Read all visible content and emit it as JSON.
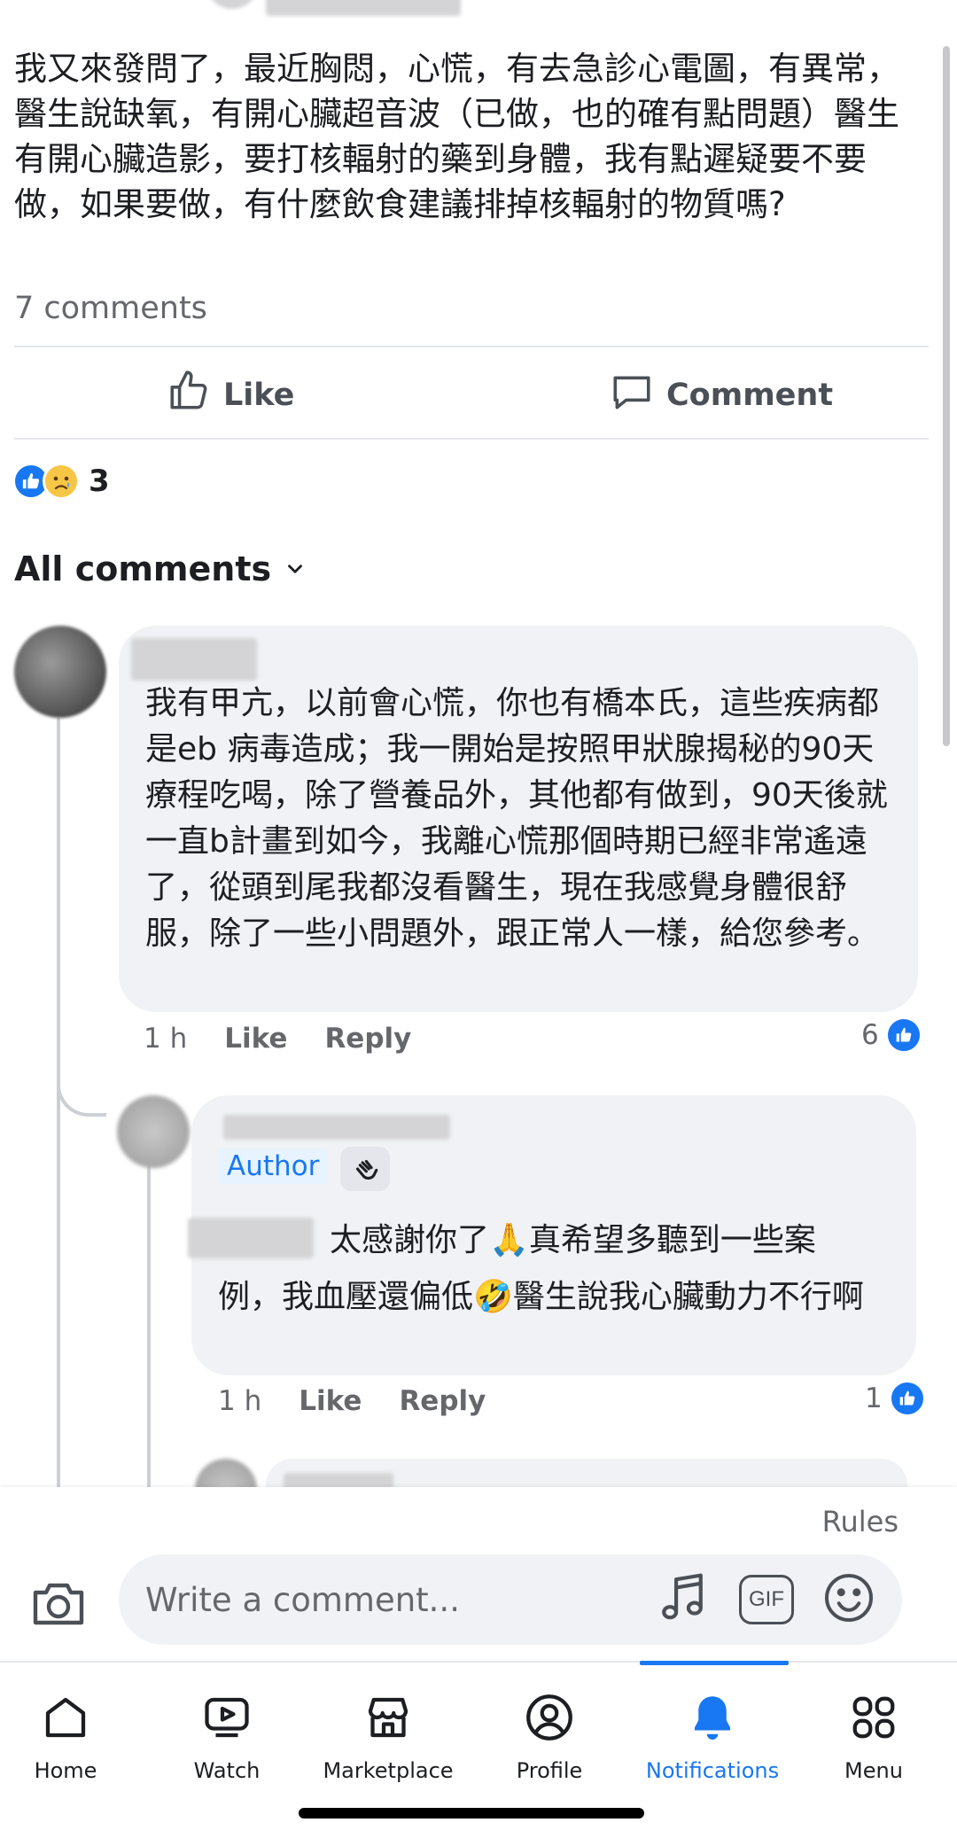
{
  "post": {
    "text": "我又來發問了，最近胸悶，心慌，有去急診心電圖，有異常，醫生說缺氧，有開心臟超音波（已做，也的確有點問題）醫生有開心臟造影，要打核輻射的藥到身體，我有點遲疑要不要做，如果要做，有什麼飲食建議排掉核輻射的物質嗎?",
    "comment_count": "7 comments",
    "reaction_count": "3"
  },
  "actions": {
    "like_label": "Like",
    "comment_label": "Comment"
  },
  "filter": {
    "label": "All comments"
  },
  "comments": [
    {
      "text": "我有甲亢，以前會心慌，你也有橋本氏，這些疾病都是eb 病毒造成；我一開始是按照甲狀腺揭秘的90天療程吃喝，除了營養品外，其他都有做到，90天後就一直b計畫到如今，我離心慌那個時期已經非常遙遠了，從頭到尾我都沒看醫生，現在我感覺身體很舒服，除了一些小問題外，跟正常人一樣，給您參考。",
      "time": "1 h",
      "like_label": "Like",
      "reply_label": "Reply",
      "like_count": "6"
    }
  ],
  "reply": {
    "author_badge": "Author",
    "text_line1": "太感謝你了🙏真希望多聽到一些案",
    "text_rest": "例，我血壓還偏低🤣醫生說我心臟動力不行啊",
    "time": "1 h",
    "like_label": "Like",
    "reply_label": "Reply",
    "like_count": "1"
  },
  "composer": {
    "rules_label": "Rules",
    "placeholder": "Write a comment...",
    "gif_label": "GIF"
  },
  "tabs": [
    {
      "label": "Home",
      "icon": "home-icon"
    },
    {
      "label": "Watch",
      "icon": "watch-icon"
    },
    {
      "label": "Marketplace",
      "icon": "marketplace-icon"
    },
    {
      "label": "Profile",
      "icon": "profile-icon"
    },
    {
      "label": "Notifications",
      "icon": "bell-icon",
      "active": true
    },
    {
      "label": "Menu",
      "icon": "menu-grid-icon"
    }
  ],
  "colors": {
    "accent": "#1877f2",
    "bubble": "#f0f2f5",
    "muted_text": "#65676b"
  }
}
